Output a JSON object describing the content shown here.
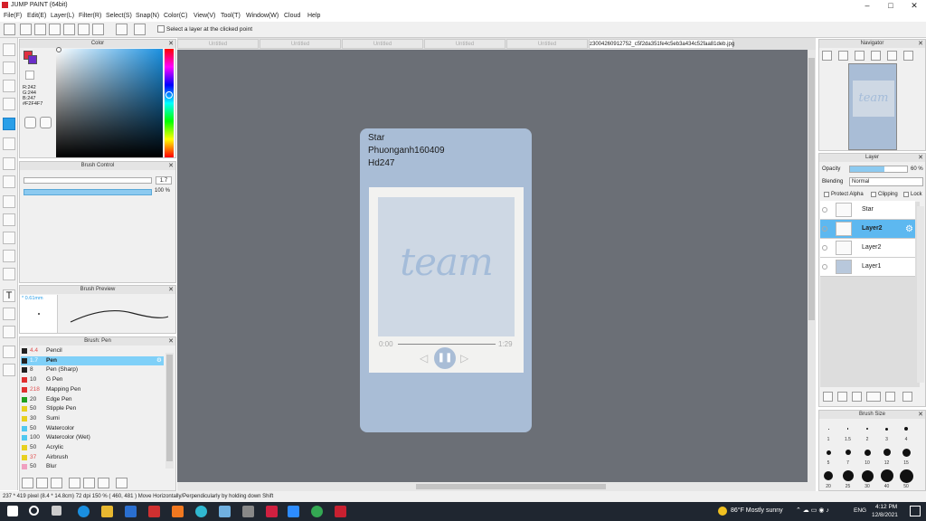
{
  "window": {
    "title": "JUMP PAINT (64bit)"
  },
  "menu": [
    "File(F)",
    "Edit(E)",
    "Layer(L)",
    "Filter(R)",
    "Select(S)",
    "Snap(N)",
    "Color(C)",
    "View(V)",
    "Tool(T)",
    "Window(W)",
    "Cloud",
    "Help"
  ],
  "toolbar": {
    "select_layer_label": "Select a layer at the clicked point"
  },
  "color_panel": {
    "title": "Color",
    "r": "R:242",
    "g": "G:244",
    "b": "B:247",
    "hex": "#F2F4F7"
  },
  "brush_control": {
    "title": "Brush Control",
    "size": "1.7",
    "opacity": "100 %"
  },
  "brush_preview": {
    "title": "Brush Preview",
    "size": "* 0.61mm"
  },
  "brush_list": {
    "title": "Brush: Pen",
    "items": [
      {
        "size": "4.4",
        "name": "Pencil",
        "color": "#222222"
      },
      {
        "size": "1.7",
        "name": "Pen",
        "color": "#222222",
        "selected": true
      },
      {
        "size": "8",
        "name": "Pen (Sharp)",
        "color": "#222222"
      },
      {
        "size": "10",
        "name": "G Pen",
        "color": "#e03030"
      },
      {
        "size": "218",
        "name": "Mapping Pen",
        "color": "#e03030"
      },
      {
        "size": "20",
        "name": "Edge Pen",
        "color": "#20a020"
      },
      {
        "size": "50",
        "name": "Stipple Pen",
        "color": "#e8d020"
      },
      {
        "size": "30",
        "name": "Sumi",
        "color": "#e8d020"
      },
      {
        "size": "50",
        "name": "Watercolor",
        "color": "#50c8f0"
      },
      {
        "size": "100",
        "name": "Watercolor (Wet)",
        "color": "#50c8f0"
      },
      {
        "size": "50",
        "name": "Acrylic",
        "color": "#e8d020"
      },
      {
        "size": "37",
        "name": "Airbrush",
        "color": "#e8d020"
      },
      {
        "size": "50",
        "name": "Blur",
        "color": "#f0a0c0"
      }
    ]
  },
  "tabs": [
    "Untitled",
    "Untitled",
    "Untitled",
    "Untitled",
    "Untitled",
    "z3004260912752_c5f2da351fe4c5eb3a434c52faa81deb.jpg"
  ],
  "document": {
    "lines": [
      "Star",
      "Phuonganh160409",
      "Hd247"
    ],
    "logo": "team",
    "time_start": "0:00",
    "time_end": "1:29"
  },
  "navigator": {
    "title": "Navigator",
    "thumb_logo": "team"
  },
  "layer_panel": {
    "title": "Layer",
    "opacity_label": "Opacity",
    "opacity_value": "60 %",
    "blending_label": "Blending",
    "blending_value": "Normal",
    "protect_alpha": "Protect Alpha",
    "clipping": "Clipping",
    "lock": "Lock",
    "layers": [
      {
        "name": "Star",
        "selected": false
      },
      {
        "name": "Layer2",
        "selected": true
      },
      {
        "name": "Layer2",
        "selected": false
      },
      {
        "name": "Layer1",
        "selected": false
      }
    ]
  },
  "brush_size": {
    "title": "Brush Size",
    "sizes": [
      "1",
      "1.5",
      "2",
      "3",
      "4",
      "5",
      "7",
      "10",
      "12",
      "15",
      "20",
      "25",
      "30",
      "40",
      "50"
    ]
  },
  "status": {
    "text": "237 * 419 pixel  (8.4 * 14.8cm)  72 dpi  150 %  ( 460, 481 )  Move Horizontally/Perpendicularly by holding down Shift"
  },
  "taskbar": {
    "weather": "86°F  Mostly sunny",
    "lang": "ENG",
    "time": "4:12 PM",
    "date": "12/8/2021"
  }
}
